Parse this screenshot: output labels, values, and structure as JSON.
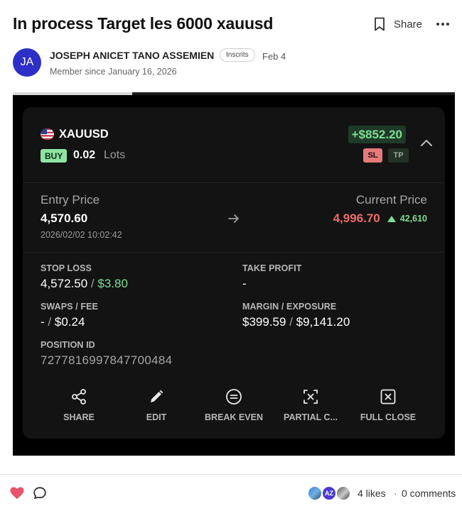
{
  "post": {
    "title": "In process Target les 6000 xauusd",
    "share_label": "Share",
    "author": {
      "initials": "JA",
      "name": "JOSEPH ANICET TANO ASSEMIEN",
      "badge": "Inscrits",
      "date": "Feb 4",
      "member_since": "Member since January 16, 2026"
    }
  },
  "media": {
    "progress_fraction": 0.27
  },
  "trade": {
    "symbol": "XAUUSD",
    "side": "BUY",
    "lots": "0.02",
    "lots_unit": "Lots",
    "pnl": "+$852.20",
    "sl_badge": "SL",
    "tp_badge": "TP",
    "entry_label": "Entry Price",
    "entry_price": "4,570.60",
    "entry_time": "2026/02/02 10:02:42",
    "current_label": "Current Price",
    "current_price": "4,996.70",
    "current_change": "42,610",
    "stop_loss_label": "STOP LOSS",
    "stop_loss_value": "4,572.50",
    "stop_loss_sep": "/",
    "stop_loss_amount": "$3.80",
    "take_profit_label": "TAKE PROFIT",
    "take_profit_value": "-",
    "swaps_label": "SWAPS / FEE",
    "swaps_value": "-",
    "swaps_sep": "/",
    "fee_value": "$0.24",
    "margin_label": "MARGIN / EXPOSURE",
    "margin_value": "$399.59",
    "margin_sep": "/",
    "exposure_value": "$9,141.20",
    "position_id_label": "POSITION ID",
    "position_id": "7277816997847700484",
    "actions": [
      {
        "label": "SHARE",
        "icon": "share-icon"
      },
      {
        "label": "EDIT",
        "icon": "pencil-icon"
      },
      {
        "label": "BREAK EVEN",
        "icon": "equals-circle-icon"
      },
      {
        "label": "PARTIAL C...",
        "icon": "partial-close-icon"
      },
      {
        "label": "FULL CLOSE",
        "icon": "close-box-icon"
      }
    ]
  },
  "footer": {
    "reactor_initials": "AZ",
    "likes": "4 likes",
    "separator": "·",
    "comments": "0 comments"
  },
  "colors": {
    "accent_avatar": "#2d2fc7",
    "profit_green": "#7ddf93",
    "loss_red": "#ef6b6b",
    "card_bg": "#131313",
    "heart": "#e8546a"
  }
}
